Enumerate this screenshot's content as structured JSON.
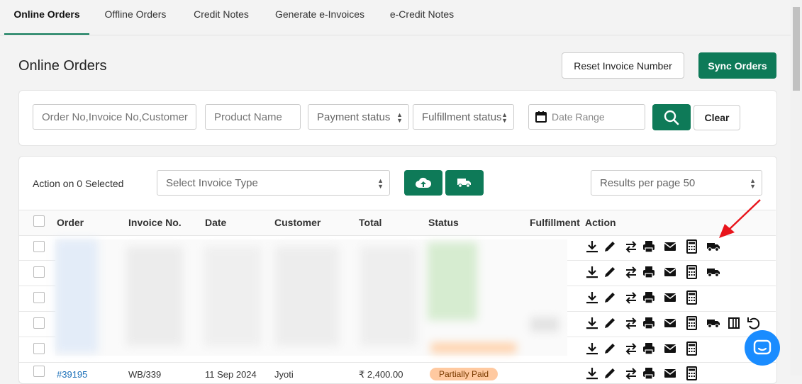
{
  "tabs": [
    "Online Orders",
    "Offline Orders",
    "Credit Notes",
    "Generate e-Invoices",
    "e-Credit Notes"
  ],
  "page_title": "Online Orders",
  "buttons": {
    "reset": "Reset Invoice Number",
    "sync": "Sync Orders",
    "clear": "Clear"
  },
  "filters": {
    "order_placeholder": "Order No,Invoice No,Customer",
    "product_placeholder": "Product Name",
    "payment_status": "Payment status",
    "fulfillment_status": "Fulfillment status",
    "date_range": "Date Range"
  },
  "bulk": {
    "action_label": "Action on 0 Selected",
    "invoice_type": "Select Invoice Type",
    "results_per_page": "Results per page 50"
  },
  "columns": [
    "Order",
    "Invoice No.",
    "Date",
    "Customer",
    "Total",
    "Status",
    "Fulfillment",
    "Action"
  ],
  "visible_row": {
    "order": "#39195",
    "invoice": "WB/339",
    "date": "11 Sep 2024",
    "customer": "Jyoti",
    "total": "₹ 2,400.00",
    "status": "Partially Paid"
  },
  "row_actions": [
    [
      "download-icon",
      "edit-icon",
      "transfer-icon",
      "print-icon",
      "email-icon",
      "calculator-icon",
      "truck-icon"
    ],
    [
      "download-icon",
      "edit-icon",
      "transfer-icon",
      "print-icon",
      "email-icon",
      "calculator-icon",
      "truck-icon"
    ],
    [
      "download-icon",
      "edit-icon",
      "transfer-icon",
      "print-icon",
      "email-icon",
      "calculator-icon"
    ],
    [
      "download-icon",
      "edit-icon",
      "transfer-icon",
      "print-icon",
      "email-icon",
      "calculator-icon",
      "truck-icon",
      "columns-icon",
      "undo-icon"
    ],
    [
      "download-icon",
      "edit-icon",
      "transfer-icon",
      "print-icon",
      "email-icon",
      "calculator-icon"
    ],
    [
      "download-icon",
      "edit-icon",
      "transfer-icon",
      "print-icon",
      "email-icon",
      "calculator-icon"
    ]
  ],
  "colors": {
    "accent": "#0e7a58",
    "chat": "#1a8cff",
    "arrow": "#e8141b",
    "badge": "#ffc9a0"
  }
}
